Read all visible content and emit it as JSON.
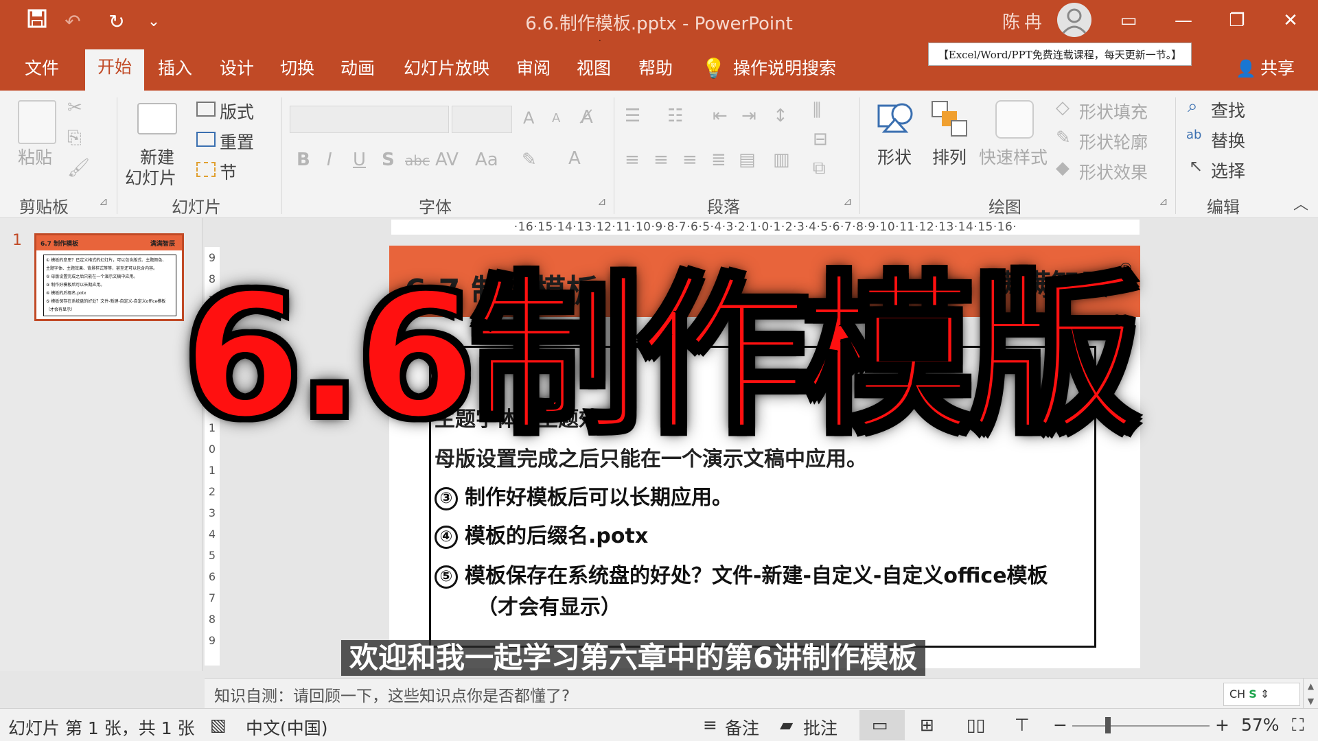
{
  "window": {
    "title": "6.6.制作模板.pptx  -  PowerPoint",
    "user": "陈冉",
    "minimize": "—",
    "restore": "❐",
    "close": "✕",
    "ribbon_display": "▭"
  },
  "qat": {
    "save": "💾",
    "undo": "↶",
    "redo": "↻",
    "more": "⌄"
  },
  "tabs": [
    "文件",
    "开始",
    "插入",
    "设计",
    "切换",
    "动画",
    "幻灯片放映",
    "审阅",
    "视图",
    "帮助"
  ],
  "active_tab": "开始",
  "tell_me": "操作说明搜索",
  "promo_banner": "【Excel/Word/PPT免费连载课程，每天更新一节。】",
  "share": "共享",
  "ribbon": {
    "clipboard": {
      "group": "剪贴板",
      "paste": "粘贴"
    },
    "slides": {
      "group": "幻灯片",
      "new_slide_line1": "新建",
      "new_slide_line2": "幻灯片",
      "layout": "版式",
      "reset": "重置",
      "section": "节"
    },
    "font": {
      "group": "字体",
      "bold": "B",
      "italic": "I",
      "underline": "U",
      "shadow": "S",
      "strike": "abc",
      "spacing": "AV",
      "case": "Aa",
      "grow": "A",
      "shrink": "A",
      "color": "A"
    },
    "paragraph": {
      "group": "段落"
    },
    "drawing": {
      "group": "绘图",
      "shape": "形状",
      "arrange": "排列",
      "quick_styles": "快速样式",
      "fill": "形状填充",
      "outline": "形状轮廓",
      "effects": "形状效果"
    },
    "editing": {
      "group": "编辑",
      "find": "查找",
      "replace": "替换",
      "select": "选择"
    }
  },
  "thumbnail": {
    "number": "1",
    "title": "6.7 制作模板",
    "brand": "满满智辰",
    "lines": [
      "① 模板的意思？已定义格式的幻灯片，可以包含版式、主题颜色、",
      "主题字体、主题效果、背景样式等等，甚至还可以包含内容。",
      "② 母版设置完成之后只能在一个演示文稿中应用。",
      "③ 制作好模板后可以长期应用。",
      "④ 模板的后缀名.potx",
      "⑤ 模板保存在系统盘的好处？文件-新建-自定义-自定义office模板",
      "（才会有显示）"
    ]
  },
  "ruler_h": "·16·15·14·13·12·11·10·9·8·7·6·5·4·3·2·1·0·1·2·3·4·5·6·7·8·9·10·11·12·13·14·15·16·",
  "ruler_v": [
    "9",
    "8",
    "7",
    "6",
    "5",
    "4",
    "3",
    "2",
    "1",
    "0",
    "1",
    "2",
    "3",
    "4",
    "5",
    "6",
    "7",
    "8",
    "9"
  ],
  "slide": {
    "title": "6.7 制作模板",
    "brand": "满满智辰",
    "registered": "®",
    "items": [
      {
        "num": "③",
        "text": "制作好模板后可以长期应用。"
      },
      {
        "num": "④",
        "text": "模板的后缀名.potx"
      },
      {
        "num": "⑤",
        "text": "模板保存在系统盘的好处？文件-新建-自定义-自定义office模板"
      },
      {
        "num": "",
        "text": "（才会有显示）"
      }
    ],
    "partial_line": "母版设置完成之后只能在一个演示文稿中应用。",
    "partial_line2": "主题字体、主题效果"
  },
  "overlay_title": "6.6制作模版",
  "caption": "欢迎和我一起学习第六章中的第6讲制作模板",
  "notes": "知识自测：请回顾一下，这些知识点你是否都懂了?",
  "ime": "CH",
  "status": {
    "slide_info": "幻灯片 第 1 张，共 1 张",
    "language": "中文(中国)",
    "notes_btn": "备注",
    "comments_btn": "批注",
    "zoom_minus": "−",
    "zoom_plus": "+",
    "zoom": "57%"
  },
  "colors": {
    "accent": "#c14a26",
    "slide_header": "#e8643b",
    "overlay_red": "#ff1010"
  }
}
